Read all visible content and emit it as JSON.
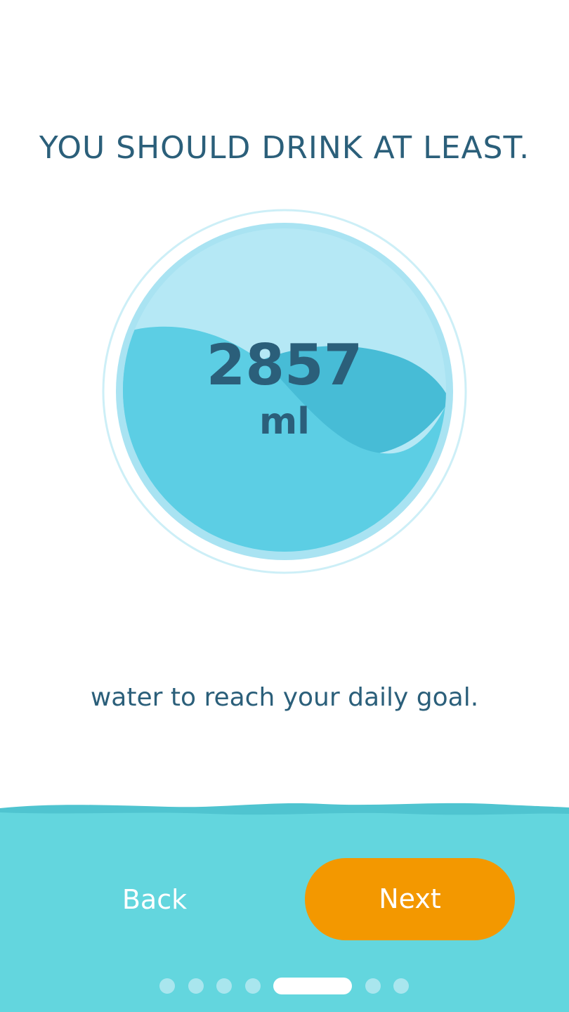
{
  "onboarding": {
    "headline": "YOU SHOULD DRINK AT LEAST.",
    "goal_value": "2857",
    "goal_unit": "ml",
    "subtext": "water to reach your daily goal."
  },
  "navigation": {
    "back_label": "Back",
    "next_label": "Next"
  },
  "pager": {
    "total_pages": 7,
    "current_page": 5
  },
  "colors": {
    "text": "#2b5f7a",
    "accent": "#f39800",
    "water": "#5ecfe4",
    "footer": "#63d6de"
  }
}
